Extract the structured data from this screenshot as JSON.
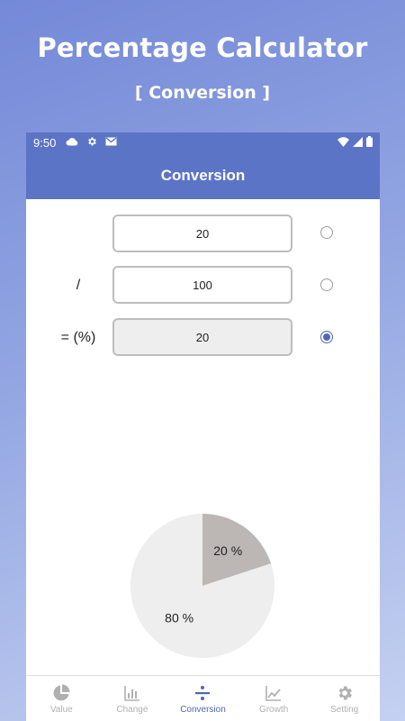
{
  "promo": {
    "title": "Percentage Calculator",
    "subtitle": "[ Conversion ]"
  },
  "status_bar": {
    "time": "9:50",
    "left_icons": [
      "cloud-icon",
      "gear-icon",
      "mail-icon"
    ],
    "right_icons": [
      "wifi-icon",
      "signal-icon",
      "battery-icon"
    ]
  },
  "app_bar": {
    "title": "Conversion"
  },
  "form": {
    "rows": [
      {
        "label": "",
        "value": "20",
        "selected": false
      },
      {
        "label": "/",
        "value": "100",
        "selected": false
      },
      {
        "label": "= (%)",
        "value": "20",
        "selected": true
      }
    ]
  },
  "chart_data": {
    "type": "pie",
    "slices": [
      {
        "label": "20 %",
        "value": 20,
        "color": "#bcb6b5"
      },
      {
        "label": "80 %",
        "value": 80,
        "color": "#eeeeee"
      }
    ]
  },
  "bottom_nav": {
    "items": [
      {
        "label": "Value",
        "icon": "pie-chart-icon",
        "active": false
      },
      {
        "label": "Change",
        "icon": "bar-chart-icon",
        "active": false
      },
      {
        "label": "Conversion",
        "icon": "divide-icon",
        "active": true
      },
      {
        "label": "Growth",
        "icon": "trending-up-icon",
        "active": false
      },
      {
        "label": "Setting",
        "icon": "gear-icon",
        "active": false
      }
    ]
  },
  "colors": {
    "primary": "#5b74c6",
    "accent": "#4f67b5",
    "inactive": "#b0b0b0"
  }
}
